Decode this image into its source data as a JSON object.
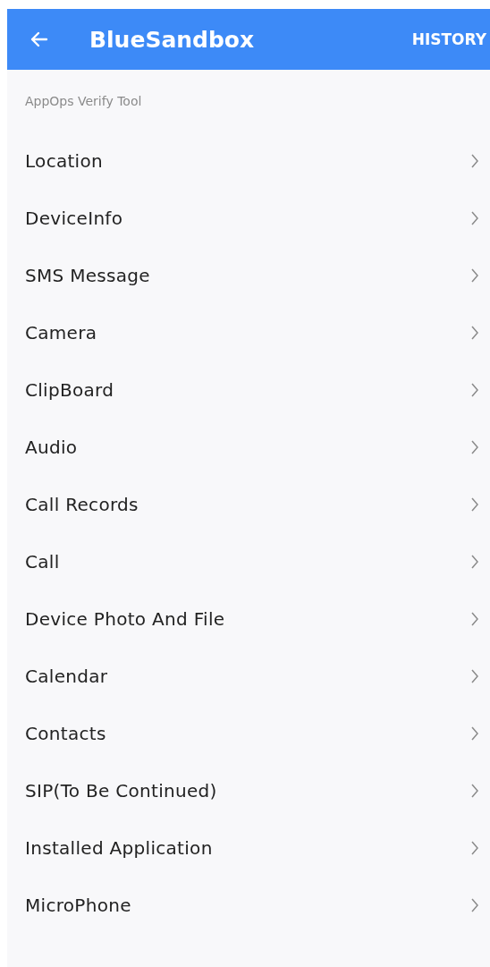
{
  "app_bar": {
    "title": "BlueSandbox",
    "action": "HISTORY"
  },
  "section_title": "AppOps Verify Tool",
  "items": [
    {
      "label": "Location"
    },
    {
      "label": "DeviceInfo"
    },
    {
      "label": "SMS Message"
    },
    {
      "label": "Camera"
    },
    {
      "label": "ClipBoard"
    },
    {
      "label": "Audio"
    },
    {
      "label": "Call Records"
    },
    {
      "label": "Call"
    },
    {
      "label": "Device Photo And File"
    },
    {
      "label": "Calendar"
    },
    {
      "label": "Contacts"
    },
    {
      "label": "SIP(To Be Continued)"
    },
    {
      "label": "Installed Application"
    },
    {
      "label": "MicroPhone"
    }
  ]
}
